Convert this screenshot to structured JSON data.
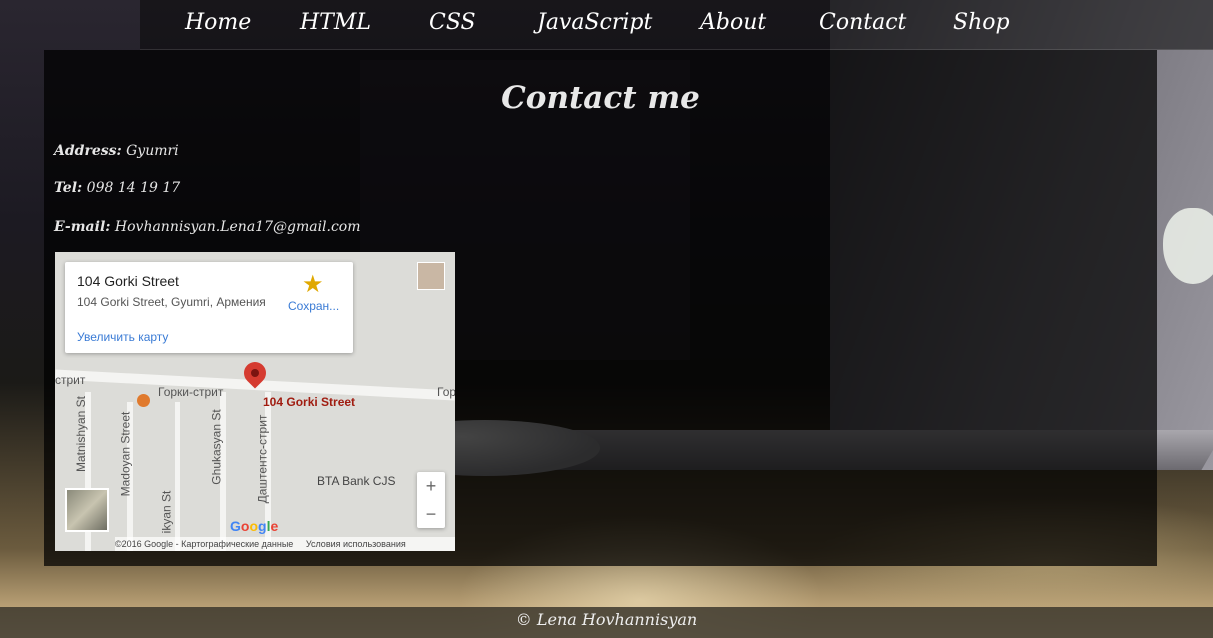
{
  "nav": {
    "items": [
      {
        "label": "Home"
      },
      {
        "label": "HTML"
      },
      {
        "label": "CSS"
      },
      {
        "label": "JavaScript"
      },
      {
        "label": "About"
      },
      {
        "label": "Contact"
      },
      {
        "label": "Shop"
      }
    ]
  },
  "contact": {
    "title": "Contact me",
    "address_label": "Address:",
    "address_value": "Gyumri",
    "tel_label": "Tel:",
    "tel_value": "098 14 19 17",
    "email_label": "E-mail:",
    "email_value": "Hovhannisyan.Lena17@gmail.com"
  },
  "map": {
    "card": {
      "place_name": "104 Gorki Street",
      "place_address": "104 Gorki Street, Gyumri, Армения",
      "save_label": "Сохран...",
      "enlarge_link": "Увеличить карту"
    },
    "marker_label": "104 Gorki Street",
    "streets": {
      "gorki_1": "стрит",
      "gorki_2": "Горки-стрит",
      "gorki_3": "Гор",
      "matnishyan": "Matnishyan St",
      "madoyan": "Madoyan Street",
      "ghukasyan": "Ghukasyan St",
      "dashtents": "Даштентс-стрит",
      "ikyan": "ikyan St"
    },
    "poi_bank": "BTA Bank CJS",
    "zoom_in": "+",
    "zoom_out": "−",
    "google_logo": "Google",
    "attribution": "©2016 Google - Картографические данные",
    "terms": "Условия использования"
  },
  "footer": {
    "text": "© Lena Hovhannisyan"
  },
  "colors": {
    "map_link": "#3a7bd5",
    "marker": "#d53b30",
    "star": "#e0a800"
  }
}
